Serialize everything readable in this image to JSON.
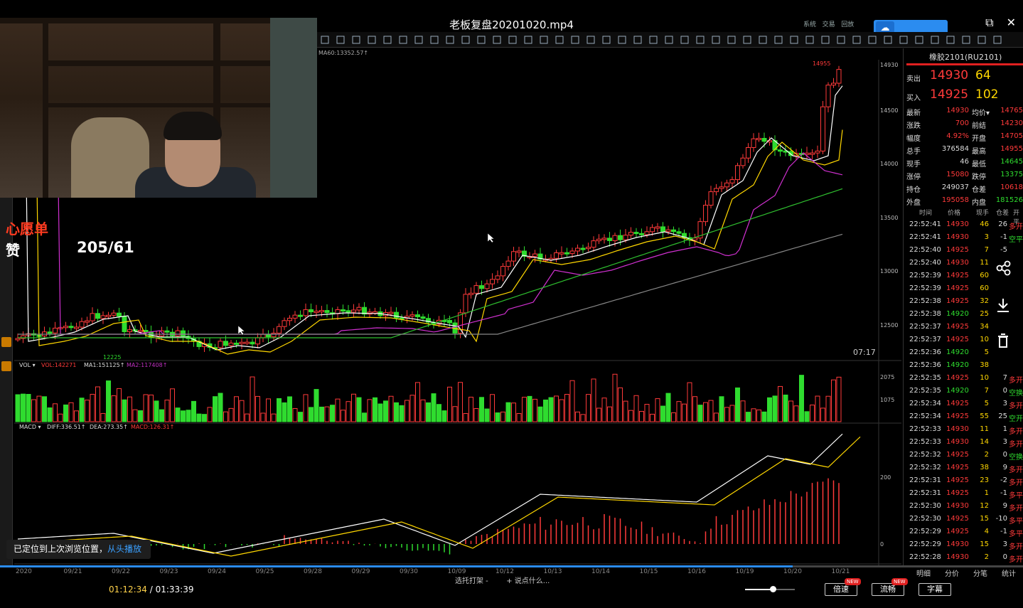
{
  "window": {
    "title": "老板复盘20201020.mp4",
    "controls": [
      "⧉",
      "✕"
    ]
  },
  "terminal": {
    "ma_line_label": "MA60:13352.57↑",
    "time_corner": "07:17",
    "price_axis": [
      "14930",
      "14500",
      "14000",
      "13500",
      "13000",
      "12500"
    ],
    "high_marker": "14955",
    "low_marker": "12225",
    "vol_legend": {
      "vol": "VOL ▾",
      "v": "VOL:142271",
      "ma1": "MA1:151125↑",
      "ma2": "MA2:117408↑"
    },
    "vol_axis": [
      "2075",
      "1075"
    ],
    "macd_legend": {
      "macd": "MACD ▾",
      "diff": "DIFF:336.51↑",
      "dea": "DEA:273.35↑",
      "m": "MACD:126.31↑"
    },
    "macd_axis": [
      "200",
      "0"
    ],
    "date_axis": [
      "2020",
      "09/21",
      "09/22",
      "09/23",
      "09/24",
      "09/25",
      "09/28",
      "09/29",
      "09/30",
      "10/09",
      "10/12",
      "10/13",
      "10/14",
      "10/15",
      "10/16",
      "10/19",
      "10/20",
      "10/21"
    ],
    "menu": [
      "系统",
      "交易",
      "回放"
    ]
  },
  "overlay": {
    "wish": "心愿单",
    "like_label": "赞",
    "like_count": "205/61"
  },
  "quote": {
    "header": "橡胶2101(RU2101)",
    "ask_label": "卖出",
    "ask_price": "14930",
    "ask_vol": "64",
    "bid_label": "买入",
    "bid_price": "14925",
    "bid_vol": "102",
    "stats": [
      {
        "k": "最新",
        "v": "14930",
        "k2": "均价▾",
        "v2": "14765"
      },
      {
        "k": "涨跌",
        "v": "700",
        "k2": "前结",
        "v2": "14230"
      },
      {
        "k": "幅度",
        "v": "4.92%",
        "k2": "开盘",
        "v2": "14705"
      },
      {
        "k": "总手",
        "v": "376584",
        "k2": "最高",
        "v2": "14955"
      },
      {
        "k": "现手",
        "v": "46",
        "k2": "最低",
        "v2": "14645"
      },
      {
        "k": "涨停",
        "v": "15080",
        "k2": "跌停",
        "v2": "13375"
      },
      {
        "k": "持仓",
        "v": "249037",
        "k2": "仓差",
        "v2": "10618"
      },
      {
        "k": "外盘",
        "v": "195058",
        "k2": "内盘",
        "v2": "181526"
      }
    ],
    "tick_headers": [
      "时间",
      "价格",
      "现手",
      "仓差",
      "开平"
    ],
    "ticks": [
      [
        "22:52:41",
        "14930",
        "46",
        "26",
        "多开"
      ],
      [
        "22:52:41",
        "14930",
        "3",
        "-1",
        "空平"
      ],
      [
        "22:52:40",
        "14925",
        "7",
        "-5",
        ""
      ],
      [
        "22:52:40",
        "14930",
        "11",
        "",
        ""
      ],
      [
        "22:52:39",
        "14925",
        "60",
        "",
        ""
      ],
      [
        "22:52:39",
        "14925",
        "60",
        "",
        ""
      ],
      [
        "22:52:38",
        "14925",
        "32",
        "",
        ""
      ],
      [
        "22:52:38",
        "14920",
        "25",
        "",
        ""
      ],
      [
        "22:52:37",
        "14925",
        "34",
        "",
        ""
      ],
      [
        "22:52:37",
        "14925",
        "10",
        "",
        ""
      ],
      [
        "22:52:36",
        "14920",
        "5",
        "",
        ""
      ],
      [
        "22:52:36",
        "14920",
        "38",
        "",
        ""
      ],
      [
        "22:52:35",
        "14925",
        "10",
        "7",
        "多开"
      ],
      [
        "22:52:35",
        "14920",
        "7",
        "0",
        "空换"
      ],
      [
        "22:52:34",
        "14925",
        "5",
        "3",
        "多开"
      ],
      [
        "22:52:34",
        "14925",
        "55",
        "25",
        "空开"
      ],
      [
        "22:52:33",
        "14930",
        "11",
        "1",
        "多开"
      ],
      [
        "22:52:33",
        "14930",
        "14",
        "3",
        "多开"
      ],
      [
        "22:52:32",
        "14925",
        "2",
        "0",
        "空换"
      ],
      [
        "22:52:32",
        "14925",
        "38",
        "9",
        "多开"
      ],
      [
        "22:52:31",
        "14925",
        "23",
        "-2",
        "多开"
      ],
      [
        "22:52:31",
        "14925",
        "1",
        "-1",
        "多平"
      ],
      [
        "22:52:30",
        "14930",
        "12",
        "9",
        "多开"
      ],
      [
        "22:52:30",
        "14925",
        "15",
        "-10",
        "多平"
      ],
      [
        "22:52:29",
        "14925",
        "4",
        "-1",
        "多平"
      ],
      [
        "22:52:29",
        "14930",
        "15",
        "3",
        "多开"
      ],
      [
        "22:52:28",
        "14930",
        "2",
        "0",
        "多开"
      ]
    ],
    "bottom_tabs": [
      "明细",
      "分价",
      "分笔",
      "统计"
    ]
  },
  "toast": {
    "text": "已定位到上次浏览位置，",
    "link": "从头播放"
  },
  "player": {
    "time_current": "01:12:34",
    "time_sep": " / ",
    "time_total": "01:33:39",
    "mid_a": "选托打架 -",
    "mid_b": "+ 说点什么...",
    "speed": "倍速",
    "quality": "流畅",
    "subtitle": "字幕",
    "new_tag": "NEW",
    "progress": 0.775,
    "volume": 0.55
  },
  "colors": {
    "up": "#ff3a3a",
    "down": "#2fdc2f",
    "accent": "#2b8cf0"
  }
}
